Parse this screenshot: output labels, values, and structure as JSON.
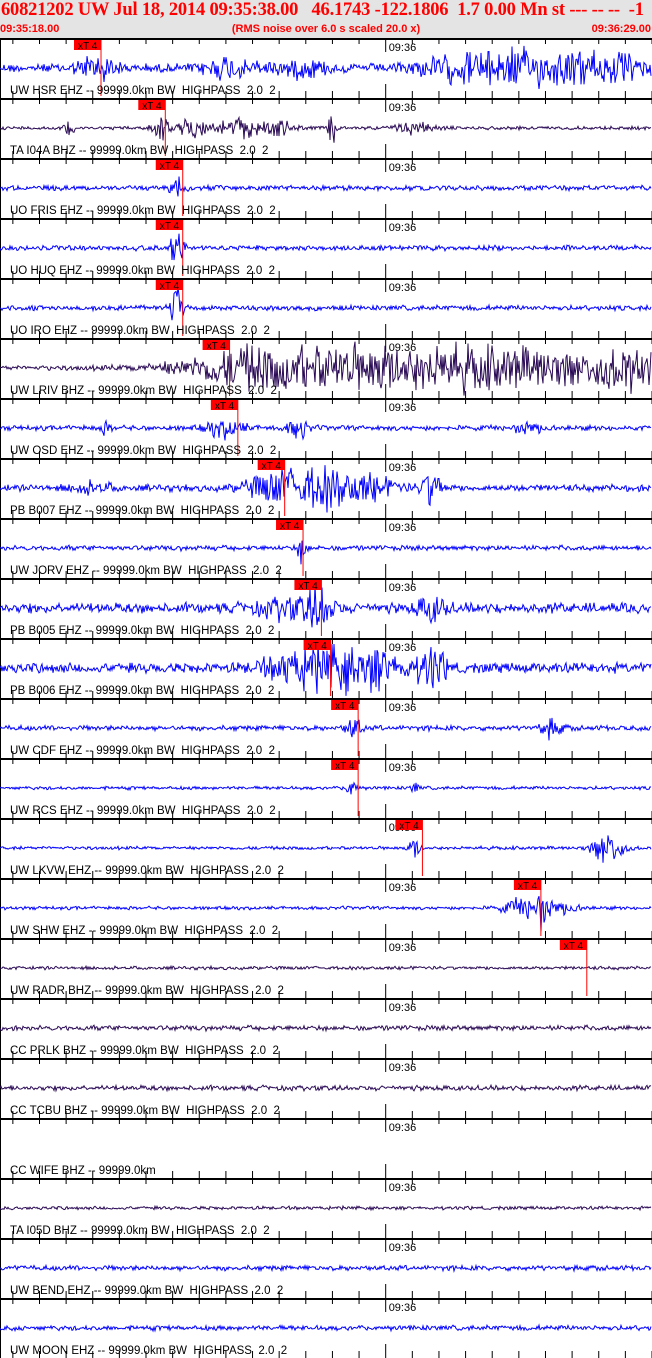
{
  "header": {
    "title": "60821202 UW Jul 18, 2014 09:35:38.00   46.1743 -122.1806  1.7 0.00 Mn st --- -- --  -1",
    "start_time": "09:35:18.00",
    "note": "(RMS noise over 6.0 s scaled 20.0 x)",
    "end_time": "09:36:29.00"
  },
  "chart_data": {
    "type": "line",
    "title": "60821202 UW Jul 18, 2014 09:35:38.00",
    "time_window_s": [
      0,
      71
    ],
    "minute_mark": {
      "label": "09:36",
      "t": 42
    },
    "tick_interval_s": 2.9,
    "pick_label": "xT 4",
    "colors": {
      "blue": "#0000ff",
      "purple": "#2a0a55",
      "pick": "#ff0000"
    },
    "traces": [
      {
        "label": "UW HSR EHZ -- 99999.0km BW  HIGHPASS  2.0  2",
        "color": "blue",
        "pick_t": 11.0,
        "noise": 5,
        "bursts": [
          [
            10.5,
            14,
            2
          ],
          [
            25,
            12,
            3
          ],
          [
            33,
            9,
            3
          ],
          [
            50,
            13,
            5
          ],
          [
            56,
            14,
            4
          ],
          [
            62,
            13,
            5
          ],
          [
            67,
            11,
            4
          ]
        ]
      },
      {
        "label": "TA I04A BHZ -- 99999.0km BW  HIGHPASS  2.0  2",
        "color": "purple",
        "pick_t": 18.0,
        "noise": 2,
        "bursts": [
          [
            7.5,
            10,
            0.5
          ],
          [
            17.5,
            12,
            1
          ],
          [
            21,
            10,
            2
          ],
          [
            26,
            12,
            2
          ],
          [
            30,
            9,
            2
          ],
          [
            36.2,
            26,
            0.4
          ],
          [
            45,
            7,
            2
          ]
        ]
      },
      {
        "label": "UO FRIS EHZ -- 99999.0km BW  HIGHPASS  2.0  2",
        "color": "blue",
        "pick_t": 19.9,
        "noise": 3,
        "bursts": [
          [
            19.4,
            28,
            0.7
          ]
        ]
      },
      {
        "label": "UO HUQ EHZ -- 99999.0km BW  HIGHPASS  2.0  2",
        "color": "blue",
        "pick_t": 19.9,
        "noise": 3,
        "bursts": [
          [
            19.3,
            20,
            0.7
          ]
        ]
      },
      {
        "label": "UO IRO EHZ -- 99999.0km BW  HIGHPASS  2.0  2",
        "color": "blue",
        "pick_t": 19.9,
        "noise": 3,
        "bursts": [
          [
            19.3,
            30,
            0.6
          ]
        ]
      },
      {
        "label": "UW LRIV BHZ -- 99999.0km BW  HIGHPASS  2.0  2",
        "color": "purple",
        "pick_t": 25.0,
        "noise": 3,
        "bursts": [
          [
            30,
            30,
            9
          ],
          [
            40,
            28,
            6
          ],
          [
            50,
            20,
            8
          ],
          [
            62,
            18,
            9
          ],
          [
            69,
            16,
            3
          ]
        ]
      },
      {
        "label": "UW OSD EHZ -- 99999.0km BW  HIGHPASS  2.0  2",
        "color": "blue",
        "pick_t": 25.9,
        "noise": 3,
        "bursts": [
          [
            24.5,
            10,
            2
          ],
          [
            32.5,
            14,
            1
          ],
          [
            11.5,
            6,
            0.6
          ],
          [
            57.5,
            7,
            1.5
          ]
        ]
      },
      {
        "label": "PB B007 EHZ -- 99999.0km BW  HIGHPASS  2.0  2",
        "color": "blue",
        "pick_t": 31.0,
        "noise": 4,
        "bursts": [
          [
            30,
            18,
            3
          ],
          [
            35,
            22,
            3
          ],
          [
            40,
            14,
            3
          ],
          [
            47,
            24,
            1
          ],
          [
            10,
            6,
            2
          ]
        ]
      },
      {
        "label": "UW JORV EHZ -- 99999.0km BW  HIGHPASS  2.0  2",
        "color": "blue",
        "pick_t": 33.0,
        "noise": 3,
        "bursts": [
          [
            32.9,
            16,
            0.5
          ]
        ]
      },
      {
        "label": "PB B005 EHZ -- 99999.0km BW  HIGHPASS  2.0  2",
        "color": "blue",
        "pick_t": 35.0,
        "noise": 6,
        "bursts": [
          [
            34.8,
            24,
            1.5
          ],
          [
            31,
            10,
            3
          ],
          [
            47,
            14,
            1.5
          ]
        ]
      },
      {
        "label": "PB B006 EHZ -- 99999.0km BW  HIGHPASS  2.0  2",
        "color": "blue",
        "pick_t": 36.0,
        "noise": 6,
        "bursts": [
          [
            36,
            24,
            4
          ],
          [
            41,
            18,
            3
          ],
          [
            47,
            24,
            1.5
          ],
          [
            31,
            10,
            3
          ]
        ]
      },
      {
        "label": "UW CDF EHZ -- 99999.0km BW  HIGHPASS  2.0  2",
        "color": "blue",
        "pick_t": 39.0,
        "noise": 3,
        "bursts": [
          [
            38.5,
            14,
            0.8
          ],
          [
            60,
            10,
            1.2
          ]
        ]
      },
      {
        "label": "UW RCS EHZ -- 99999.0km BW  HIGHPASS  2.0  2",
        "color": "blue",
        "pick_t": 39.0,
        "noise": 2,
        "bursts": [
          [
            38.3,
            12,
            0.6
          ],
          [
            45.2,
            7,
            0.4
          ]
        ]
      },
      {
        "label": "UW LKVW EHZ -- 99999.0km BW  HIGHPASS  2.0  2",
        "color": "blue",
        "pick_t": 46.0,
        "noise": 2,
        "bursts": [
          [
            45.2,
            12,
            0.6
          ],
          [
            66.2,
            22,
            1.5
          ]
        ]
      },
      {
        "label": "UW SHW EHZ -- 99999.0km BW  HIGHPASS  2.0  2",
        "color": "blue",
        "pick_t": 58.9,
        "noise": 2,
        "bursts": [
          [
            57.5,
            12,
            2.5
          ],
          [
            59,
            16,
            0.6
          ],
          [
            61,
            6,
            2
          ]
        ]
      },
      {
        "label": "UW RADR BHZ -- 99999.0km BW  HIGHPASS  2.0  2",
        "color": "purple",
        "pick_t": 63.9,
        "noise": 2,
        "bursts": []
      },
      {
        "label": "CC PRLK BHZ -- 99999.0km BW  HIGHPASS  2.0  2",
        "color": "purple",
        "pick_t": null,
        "noise": 3,
        "bursts": []
      },
      {
        "label": "CC TCBU BHZ -- 99999.0km BW  HIGHPASS  2.0  2",
        "color": "purple",
        "pick_t": null,
        "noise": 3,
        "bursts": []
      },
      {
        "label": "CC WIFE BHZ -- 99999.0km",
        "color": "purple",
        "pick_t": null,
        "noise": 0,
        "bursts": []
      },
      {
        "label": "TA I05D BHZ -- 99999.0km BW  HIGHPASS  2.0  2",
        "color": "purple",
        "pick_t": null,
        "noise": 2,
        "bursts": []
      },
      {
        "label": "UW BEND EHZ -- 99999.0km BW  HIGHPASS  2.0  2",
        "color": "blue",
        "pick_t": null,
        "noise": 3,
        "bursts": []
      },
      {
        "label": "UW MOON EHZ -- 99999.0km BW  HIGHPASS  2.0  2",
        "color": "blue",
        "pick_t": null,
        "noise": 3,
        "bursts": []
      }
    ]
  }
}
